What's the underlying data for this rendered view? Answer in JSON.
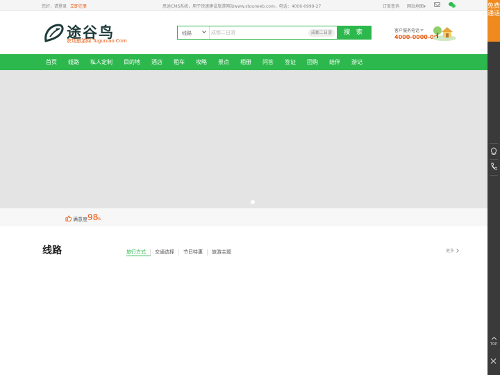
{
  "topbar": {
    "greeting": "您好，请登录",
    "register": "立即注册",
    "notice": "思途CMS系统，用于快速建设旅游网站www.stourweb.com，电话：4006-0999-27",
    "order_query": "订单查询",
    "sitemap": "网站地图▾"
  },
  "header": {
    "logo_name": "途谷鸟",
    "logo_slogan": "农场旅游网 Tuguniao.Com",
    "search": {
      "category": "线路",
      "placeholder": "成都二日游",
      "hot_tag": "成都二日游",
      "button": "搜 索"
    },
    "service": {
      "label": "客户服务电话",
      "phone": "4000-0000-00"
    }
  },
  "nav": {
    "items": [
      "首页",
      "线路",
      "私人定制",
      "目的地",
      "酒店",
      "租车",
      "攻略",
      "景点",
      "相册",
      "问答",
      "签证",
      "团购",
      "结伴",
      "游记"
    ]
  },
  "satisfaction": {
    "label": "满意度",
    "value": "98",
    "unit": "%"
  },
  "section": {
    "title": "线路",
    "tabs": [
      "旅行方式",
      "交通选择",
      "节日特惠",
      "旅游主题"
    ],
    "more": "更多"
  },
  "sidebar": {
    "free_call": "免费通话",
    "top": "TOP"
  },
  "colors": {
    "brand_green": "#2db84d",
    "accent_orange": "#e8560e",
    "sidebar_orange": "#f08a1e"
  }
}
